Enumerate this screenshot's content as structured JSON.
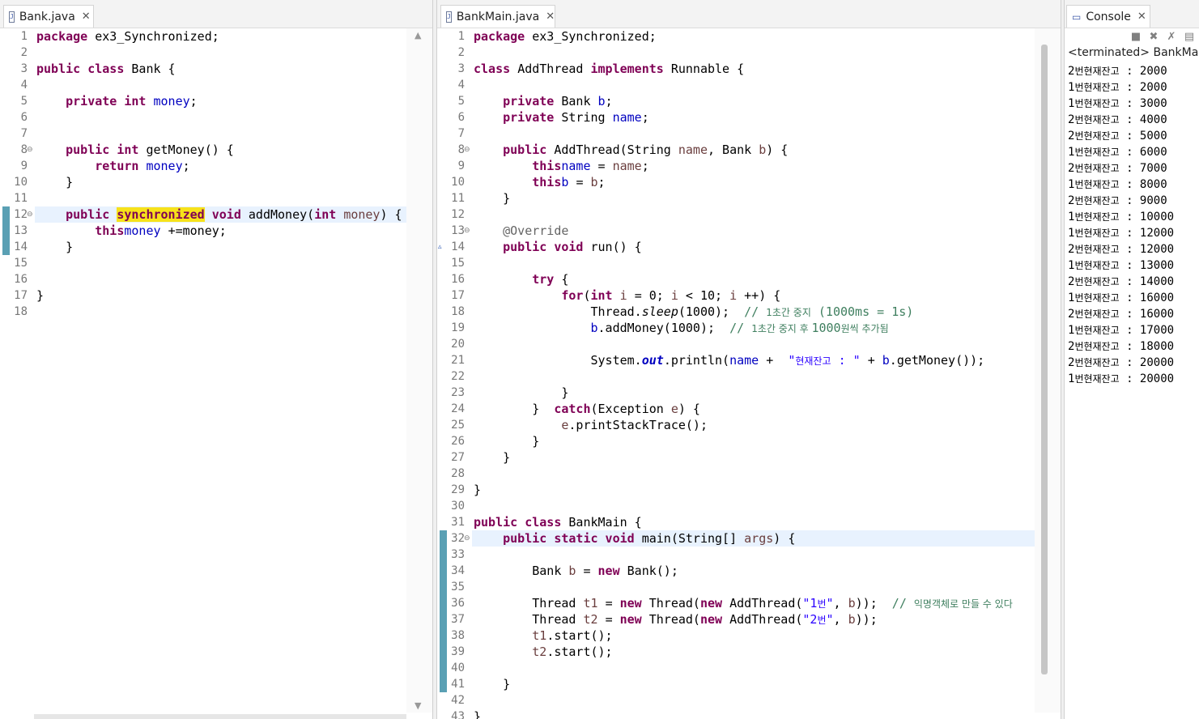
{
  "editor_left": {
    "tab_label": "Bank.java",
    "lines": [
      [
        [
          "kw",
          "package"
        ],
        [
          "",
          "ex3_Synchronized;"
        ]
      ],
      [],
      [
        [
          "kw",
          "public class"
        ],
        [
          "",
          "Bank {"
        ]
      ],
      [],
      [
        [
          "",
          "    "
        ],
        [
          "kw",
          "private int"
        ],
        [
          "fd",
          "money"
        ],
        [
          "",
          ";"
        ]
      ],
      [],
      [],
      [
        [
          "",
          "    "
        ],
        [
          "kw",
          "public int"
        ],
        [
          "",
          "getMoney() {"
        ]
      ],
      [
        [
          "",
          "        "
        ],
        [
          "kw",
          "return"
        ],
        [
          "fd",
          "money"
        ],
        [
          "",
          ";"
        ]
      ],
      [
        [
          "",
          "    }"
        ]
      ],
      [],
      [
        [
          "",
          "    "
        ],
        [
          "kw",
          "public"
        ],
        [
          "kwocc",
          "synchronized"
        ],
        [
          "kw",
          "void"
        ],
        [
          "",
          "addMoney("
        ],
        [
          "kw",
          "int"
        ],
        [
          "vr",
          "money"
        ],
        [
          "",
          ") {"
        ]
      ],
      [
        [
          "",
          "        "
        ],
        [
          "kw",
          "this"
        ],
        [
          "",
          ""
        ],
        [
          "fd",
          "money"
        ],
        [
          "",
          "+=money;"
        ]
      ],
      [
        [
          "",
          "    }"
        ]
      ],
      [],
      [],
      [
        [
          "",
          "}"
        ]
      ],
      []
    ]
  },
  "editor_right": {
    "tab_label": "BankMain.java",
    "lines": [
      [
        [
          "kw",
          "package"
        ],
        [
          "",
          "ex3_Synchronized;"
        ]
      ],
      [],
      [
        [
          "kw",
          "class"
        ],
        [
          "",
          "AddThread"
        ],
        [
          "kw",
          "implements"
        ],
        [
          "",
          "Runnable {"
        ]
      ],
      [],
      [
        [
          "",
          "    "
        ],
        [
          "kw",
          "private"
        ],
        [
          "",
          "Bank"
        ],
        [
          "fd",
          "b"
        ],
        [
          "",
          ";"
        ]
      ],
      [
        [
          "",
          "    "
        ],
        [
          "kw",
          "private"
        ],
        [
          "",
          "String"
        ],
        [
          "fd",
          "name"
        ],
        [
          "",
          ";"
        ]
      ],
      [],
      [
        [
          "",
          "    "
        ],
        [
          "kw",
          "public"
        ],
        [
          "",
          "AddThread(String"
        ],
        [
          "vr",
          "name"
        ],
        [
          "",
          ", Bank"
        ],
        [
          "vr",
          "b"
        ],
        [
          "",
          ") {"
        ]
      ],
      [
        [
          "",
          "        "
        ],
        [
          "kw",
          "this"
        ],
        [
          "",
          ""
        ],
        [
          "fd",
          "name"
        ],
        [
          "",
          "="
        ],
        [
          "vr",
          "name"
        ],
        [
          "",
          ";"
        ]
      ],
      [
        [
          "",
          "        "
        ],
        [
          "kw",
          "this"
        ],
        [
          "",
          ""
        ],
        [
          "fd",
          "b"
        ],
        [
          "",
          "="
        ],
        [
          "vr",
          "b"
        ],
        [
          "",
          ";"
        ]
      ],
      [
        [
          "",
          "    }"
        ]
      ],
      [],
      [
        [
          "",
          "    "
        ],
        [
          "an",
          "@Override"
        ]
      ],
      [
        [
          "",
          "    "
        ],
        [
          "kw",
          "public void"
        ],
        [
          "",
          "run() {"
        ]
      ],
      [],
      [
        [
          "",
          "        "
        ],
        [
          "kw",
          "try"
        ],
        [
          "",
          "{"
        ]
      ],
      [
        [
          "",
          "            "
        ],
        [
          "kw",
          "for"
        ],
        [
          "",
          "("
        ],
        [
          "kw",
          "int"
        ],
        [
          "vr",
          "i"
        ],
        [
          "",
          "= 0;"
        ],
        [
          "vr",
          "i"
        ],
        [
          "",
          "< 10;"
        ],
        [
          "vr",
          "i"
        ],
        [
          "",
          "++) {"
        ]
      ],
      [
        [
          "",
          "                Thread."
        ],
        [
          "it",
          "sleep"
        ],
        [
          "",
          "(1000); "
        ],
        [
          "cm",
          "// "
        ],
        [
          "cmko",
          "1초간 중지"
        ],
        [
          "cm",
          " (1000ms = 1s)"
        ]
      ],
      [
        [
          "",
          "                "
        ],
        [
          "fd",
          "b"
        ],
        [
          "",
          ".addMoney(1000); "
        ],
        [
          "cm",
          "// "
        ],
        [
          "cmko",
          "1초간 중지 후 "
        ],
        [
          "cm",
          "1000"
        ],
        [
          "cmko",
          "원씩 추가됨"
        ]
      ],
      [],
      [
        [
          "",
          "                System."
        ],
        [
          "sf",
          "out"
        ],
        [
          "",
          ".println("
        ],
        [
          "fd",
          "name"
        ],
        [
          "",
          "+ "
        ],
        [
          "st",
          "\""
        ],
        [
          "stko",
          "현재잔고"
        ],
        [
          "st",
          " : \""
        ],
        [
          "",
          "+"
        ],
        [
          "fd",
          "b"
        ],
        [
          "",
          ".getMoney());"
        ]
      ],
      [],
      [
        [
          "",
          "            }"
        ]
      ],
      [
        [
          "",
          "        } "
        ],
        [
          "kw",
          "catch"
        ],
        [
          "",
          "(Exception"
        ],
        [
          "vr",
          "e"
        ],
        [
          "",
          ") {"
        ]
      ],
      [
        [
          "",
          "            "
        ],
        [
          "vr",
          "e"
        ],
        [
          "",
          ".printStackTrace();"
        ]
      ],
      [
        [
          "",
          "        }"
        ]
      ],
      [
        [
          "",
          "    }"
        ]
      ],
      [],
      [
        [
          "",
          "}"
        ]
      ],
      [],
      [
        [
          "kw",
          "public class"
        ],
        [
          "",
          "BankMain {"
        ]
      ],
      [
        [
          "",
          "    "
        ],
        [
          "kw",
          "public static void"
        ],
        [
          "",
          "main(String[]"
        ],
        [
          "vr",
          "args"
        ],
        [
          "",
          ") {"
        ]
      ],
      [],
      [
        [
          "",
          "        Bank"
        ],
        [
          "vr",
          "b"
        ],
        [
          "",
          "="
        ],
        [
          "kw",
          "new"
        ],
        [
          "",
          "Bank();"
        ]
      ],
      [],
      [
        [
          "",
          "        Thread"
        ],
        [
          "vr",
          "t1"
        ],
        [
          "",
          "="
        ],
        [
          "kw",
          "new"
        ],
        [
          "",
          "Thread("
        ],
        [
          "kw",
          "new"
        ],
        [
          "",
          "AddThread("
        ],
        [
          "st",
          "\"1"
        ],
        [
          "stko",
          "번"
        ],
        [
          "st",
          "\""
        ],
        [
          "",
          ","
        ],
        [
          "vr",
          "b"
        ],
        [
          "",
          "));"
        ],
        [
          "cm",
          " // "
        ],
        [
          "cmko",
          "익명객체로 만들 수 있다"
        ]
      ],
      [
        [
          "",
          "        Thread"
        ],
        [
          "vr",
          "t2"
        ],
        [
          "",
          "="
        ],
        [
          "kw",
          "new"
        ],
        [
          "",
          "Thread("
        ],
        [
          "kw",
          "new"
        ],
        [
          "",
          "AddThread("
        ],
        [
          "st",
          "\"2"
        ],
        [
          "stko",
          "번"
        ],
        [
          "st",
          "\""
        ],
        [
          "",
          ","
        ],
        [
          "vr",
          "b"
        ],
        [
          "",
          "));"
        ]
      ],
      [
        [
          "",
          "        "
        ],
        [
          "vr",
          "t1"
        ],
        [
          "",
          ".start();"
        ]
      ],
      [
        [
          "",
          "        "
        ],
        [
          "vr",
          "t2"
        ],
        [
          "",
          ".start();"
        ]
      ],
      [],
      [
        [
          "",
          "    }"
        ]
      ],
      [],
      [
        [
          "",
          "}"
        ]
      ]
    ]
  },
  "console": {
    "tab_label": "Console",
    "status": "<terminated> BankMain",
    "lines": [
      [
        "2",
        "번현재잔고",
        " : 2000"
      ],
      [
        "1",
        "번현재잔고",
        " : 2000"
      ],
      [
        "1",
        "번현재잔고",
        " : 3000"
      ],
      [
        "2",
        "번현재잔고",
        " : 4000"
      ],
      [
        "2",
        "번현재잔고",
        " : 5000"
      ],
      [
        "1",
        "번현재잔고",
        " : 6000"
      ],
      [
        "2",
        "번현재잔고",
        " : 7000"
      ],
      [
        "1",
        "번현재잔고",
        " : 8000"
      ],
      [
        "2",
        "번현재잔고",
        " : 9000"
      ],
      [
        "1",
        "번현재잔고",
        " : 10000"
      ],
      [
        "1",
        "번현재잔고",
        " : 12000"
      ],
      [
        "2",
        "번현재잔고",
        " : 12000"
      ],
      [
        "1",
        "번현재잔고",
        " : 13000"
      ],
      [
        "2",
        "번현재잔고",
        " : 14000"
      ],
      [
        "1",
        "번현재잔고",
        " : 16000"
      ],
      [
        "2",
        "번현재잔고",
        " : 16000"
      ],
      [
        "1",
        "번현재잔고",
        " : 17000"
      ],
      [
        "2",
        "번현재잔고",
        " : 18000"
      ],
      [
        "2",
        "번현재잔고",
        " : 20000"
      ],
      [
        "1",
        "번현재잔고",
        " : 20000"
      ]
    ]
  },
  "icons": {
    "java_file": "java-file-icon",
    "close": "close-icon",
    "console": "console-icon",
    "terminate": "terminate-icon",
    "remove_launch": "remove-launch-icon",
    "remove_all": "remove-all-launches-icon",
    "new_console": "new-console-icon"
  }
}
